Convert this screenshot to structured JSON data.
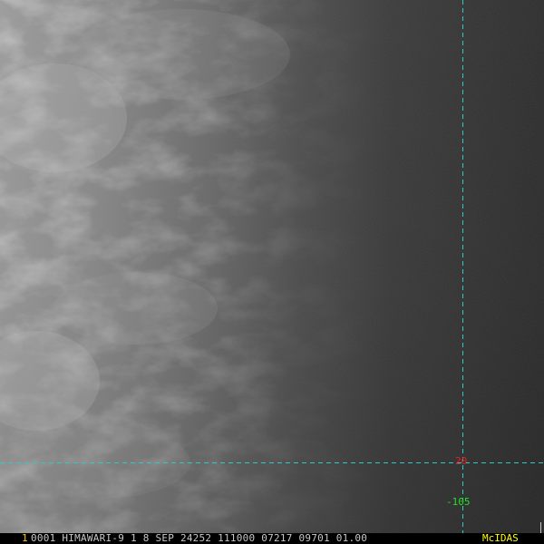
{
  "image": {
    "description_colors": {
      "background": "#2a2a2a",
      "grid_line": "#33c8c8",
      "latitude_label": "#e02020",
      "longitude_label": "#20e020",
      "frame_number": "#ffcc00",
      "header_text": "#c8c8c8",
      "brand_text": "#ffff00"
    }
  },
  "grid": {
    "latitude_label": "20",
    "longitude_label": "-105"
  },
  "status_bar": {
    "frame_number": "1",
    "header": "0001 HIMAWARI-9  1  8 SEP 24252 111000 07217 09701 01.00",
    "brand": "McIDAS"
  }
}
